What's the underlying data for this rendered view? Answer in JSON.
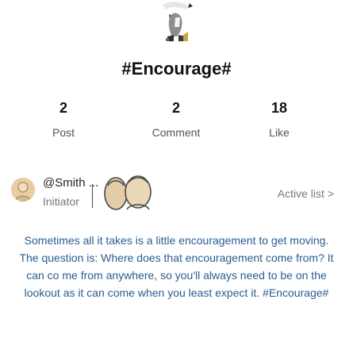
{
  "topic": {
    "title": "#Encourage#"
  },
  "stats": [
    {
      "value": "2",
      "label": "Post"
    },
    {
      "value": "2",
      "label": "Comment"
    },
    {
      "value": "18",
      "label": "Like"
    }
  ],
  "creator": {
    "name": "@Smith ...",
    "role": "Initiator"
  },
  "active_list": {
    "label": "Active list",
    "chevron": ">"
  },
  "description": "Sometimes all it takes is a little encouragement to get moving. The question is: Where does that encouragement come from? It can co me from anywhere, so you'll always need to be on the lookout as it can come when you least expect it. #Encourage#"
}
